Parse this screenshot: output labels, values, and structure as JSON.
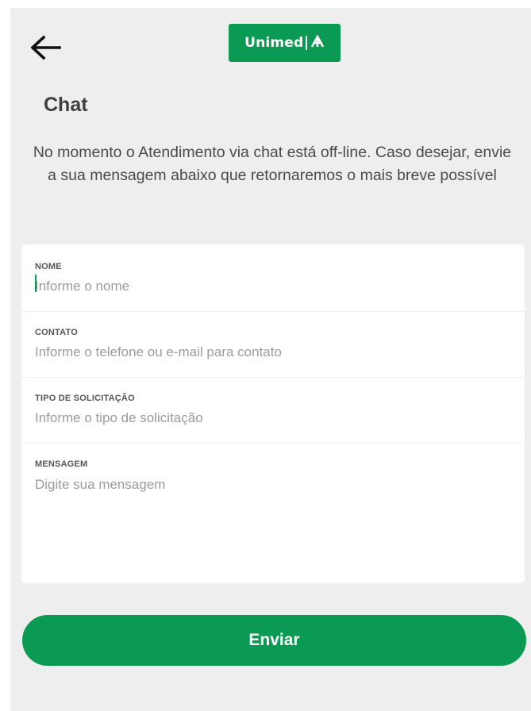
{
  "header": {
    "back_icon": "arrow-left-icon",
    "logo_text": "Unimed",
    "logo_mark": "⇮"
  },
  "page": {
    "title": "Chat",
    "notice": "No momento o Atendimento via chat está off-line. Caso desejar, envie a sua mensagem abaixo que retornaremos o mais breve possível"
  },
  "form": {
    "nome": {
      "label": "NOME",
      "placeholder": "Informe o nome",
      "value": ""
    },
    "contato": {
      "label": "CONTATO",
      "placeholder": "Informe o telefone ou e-mail para contato",
      "value": ""
    },
    "tipo": {
      "label": "TIPO DE SOLICITAÇÃO",
      "placeholder": "Informe o tipo de solicitação",
      "value": ""
    },
    "mensagem": {
      "label": "MENSAGEM",
      "placeholder": "Digite sua mensagem",
      "value": ""
    }
  },
  "actions": {
    "send_label": "Enviar"
  },
  "colors": {
    "brand_green": "#0b9a53",
    "background": "#eeeeee",
    "card": "#ffffff"
  }
}
